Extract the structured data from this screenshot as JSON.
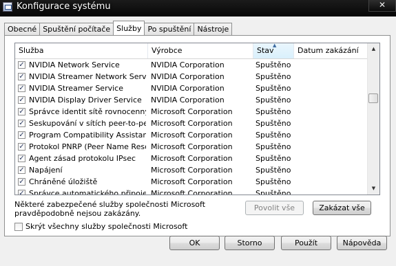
{
  "window": {
    "title": "Konfigurace systému",
    "close_glyph": "✕"
  },
  "tabs": [
    {
      "label": "Obecné"
    },
    {
      "label": "Spuštění počítače"
    },
    {
      "label": "Služby"
    },
    {
      "label": "Po spuštění"
    },
    {
      "label": "Nástroje"
    }
  ],
  "active_tab": "Služby",
  "columns": [
    "Služba",
    "Výrobce",
    "Stav",
    "Datum zakázání"
  ],
  "rows": [
    {
      "checked": true,
      "service": "NVIDIA Network Service",
      "vendor": "NVIDIA Corporation",
      "status": "Spuštěno",
      "date": ""
    },
    {
      "checked": true,
      "service": "NVIDIA Streamer Network Service",
      "vendor": "NVIDIA Corporation",
      "status": "Spuštěno",
      "date": ""
    },
    {
      "checked": true,
      "service": "NVIDIA Streamer Service",
      "vendor": "NVIDIA Corporation",
      "status": "Spuštěno",
      "date": ""
    },
    {
      "checked": true,
      "service": "NVIDIA Display Driver Service",
      "vendor": "NVIDIA Corporation",
      "status": "Spuštěno",
      "date": ""
    },
    {
      "checked": true,
      "service": "Správce identit sítě rovnocenný...",
      "vendor": "Microsoft Corporation",
      "status": "Spuštěno",
      "date": ""
    },
    {
      "checked": true,
      "service": "Seskupování v sítích peer-to-peer",
      "vendor": "Microsoft Corporation",
      "status": "Spuštěno",
      "date": ""
    },
    {
      "checked": true,
      "service": "Program Compatibility Assistant ...",
      "vendor": "Microsoft Corporation",
      "status": "Spuštěno",
      "date": ""
    },
    {
      "checked": true,
      "service": "Protokol PNRP (Peer Name Resol...",
      "vendor": "Microsoft Corporation",
      "status": "Spuštěno",
      "date": ""
    },
    {
      "checked": true,
      "service": "Agent zásad protokolu IPsec",
      "vendor": "Microsoft Corporation",
      "status": "Spuštěno",
      "date": ""
    },
    {
      "checked": true,
      "service": "Napájení",
      "vendor": "Microsoft Corporation",
      "status": "Spuštěno",
      "date": ""
    },
    {
      "checked": true,
      "service": "Chráněné úložiště",
      "vendor": "Microsoft Corporation",
      "status": "Spuštěno",
      "date": ""
    },
    {
      "checked": true,
      "service": "Správce automatického připojení...",
      "vendor": "Microsoft Corporation",
      "status": "Spuštěno",
      "date": ""
    }
  ],
  "check_glyph": "✓",
  "note": "Některé zabezpečené služby společnosti Microsoft pravděpodobně nejsou zakázány.",
  "buttons": {
    "enable_all": "Povolit vše",
    "disable_all": "Zakázat vše",
    "ok": "OK",
    "cancel": "Storno",
    "apply": "Použít",
    "help": "Nápověda"
  },
  "hide_ms": {
    "label": "Skrýt všechny služby společnosti Microsoft",
    "checked": false
  },
  "scroll_glyphs": {
    "up": "▲",
    "down": "▼",
    "sort": "▲"
  }
}
